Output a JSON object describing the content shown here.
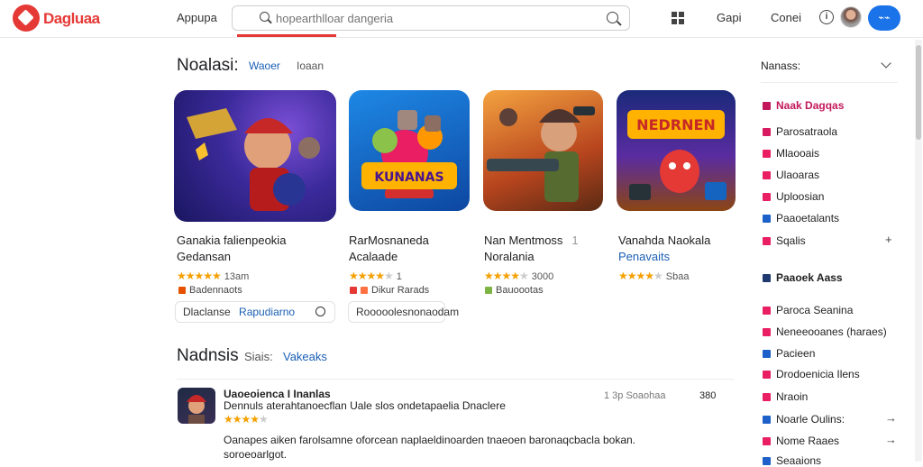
{
  "header": {
    "brand": "Dagluaa",
    "nav_apps": "Appupa",
    "search_placeholder": "hopearthlloar dangeria",
    "link_1": "Gapi",
    "link_2": "Conei",
    "info": "i",
    "account_label": "⌁⌁"
  },
  "section1": {
    "title": "Noalasi:",
    "tab_active": "Waoer",
    "tab_2": "Ioaan"
  },
  "cards": [
    {
      "title": "Ganakia falienpeokia",
      "subtitle": "Gedansan",
      "rating": "13am",
      "stars": 5,
      "badge": "Badennaots",
      "badge_color": "#e65100"
    },
    {
      "title": "RarMosnaneda",
      "subtitle": "Acalaade",
      "rating": "1",
      "stars": 4,
      "badge": "Dikur Rarads",
      "badge_color": "#e53935"
    },
    {
      "title": "Nan Mentmoss",
      "subtitle": "Noralania",
      "rating": "3000",
      "stars": 4,
      "badge": "Bauoootas",
      "badge_color": "#7cb342"
    },
    {
      "title": "Vanahda Naokala",
      "subtitle": "Penavaits",
      "rating": "Sbaa",
      "stars": 4,
      "badge": "",
      "badge_color": "#ffb300"
    }
  ],
  "card_subtitle_tag": "1",
  "pill_1": {
    "label": "Dlaclanse",
    "link": "Rapudiarno"
  },
  "pill_2": {
    "label": "Rooooolesnonaodam"
  },
  "section2": {
    "title": "Nadnsis",
    "tab_1": "Siais:",
    "tab_2": "Vakeaks"
  },
  "review": {
    "author": "Uaoeoienca I Inanlas",
    "line1": "Dennuls aterahtanoecflan Uale slos ondetapaelia Dnaclere",
    "stars": 4,
    "date": "1 3p Soaohaa",
    "count": "380",
    "body1": "Oanapes aiken farolsamne oforcean naplaeldinoarden  tnaeoen baronaqcbacla bokan.",
    "body2": "soroeoarlgot."
  },
  "sidebar": {
    "heading": "Nanass:",
    "items": [
      {
        "label": "Naak Dagqas",
        "color": "#c2185b",
        "bold": true,
        "trail": ""
      },
      {
        "label": "Parosatraola",
        "color": "#d81b60",
        "bold": false,
        "trail": ""
      },
      {
        "label": "Mlaooais",
        "color": "#e91e63",
        "bold": false,
        "trail": ""
      },
      {
        "label": "Ulaoaras",
        "color": "#e91e63",
        "bold": false,
        "trail": ""
      },
      {
        "label": "Uploosian",
        "color": "#e91e63",
        "bold": false,
        "trail": ""
      },
      {
        "label": "Paaoetalants",
        "color": "#1e60c9",
        "bold": false,
        "trail": ""
      },
      {
        "label": "Sqalis",
        "color": "#e91e63",
        "bold": false,
        "trail": "+"
      }
    ],
    "heading2": "Paaoek Aass",
    "items2": [
      {
        "label": "Paroca Seanina",
        "color": "#e91e63",
        "trail": ""
      },
      {
        "label": "Neneeooanes (haraes)",
        "color": "#e91e63",
        "trail": ""
      },
      {
        "label": "Pacieen",
        "color": "#1e60c9",
        "trail": ""
      },
      {
        "label": "Drodoenicia Ilens",
        "color": "#e91e63",
        "trail": ""
      },
      {
        "label": "Nraoin",
        "color": "#e91e63",
        "trail": ""
      },
      {
        "label": "Noarle Oulins:",
        "color": "#1e60c9",
        "trail": "→"
      },
      {
        "label": "Nome Raaes",
        "color": "#e91e63",
        "trail": "→"
      },
      {
        "label": "Seaaions",
        "color": "#1e60c9",
        "trail": ""
      }
    ]
  }
}
